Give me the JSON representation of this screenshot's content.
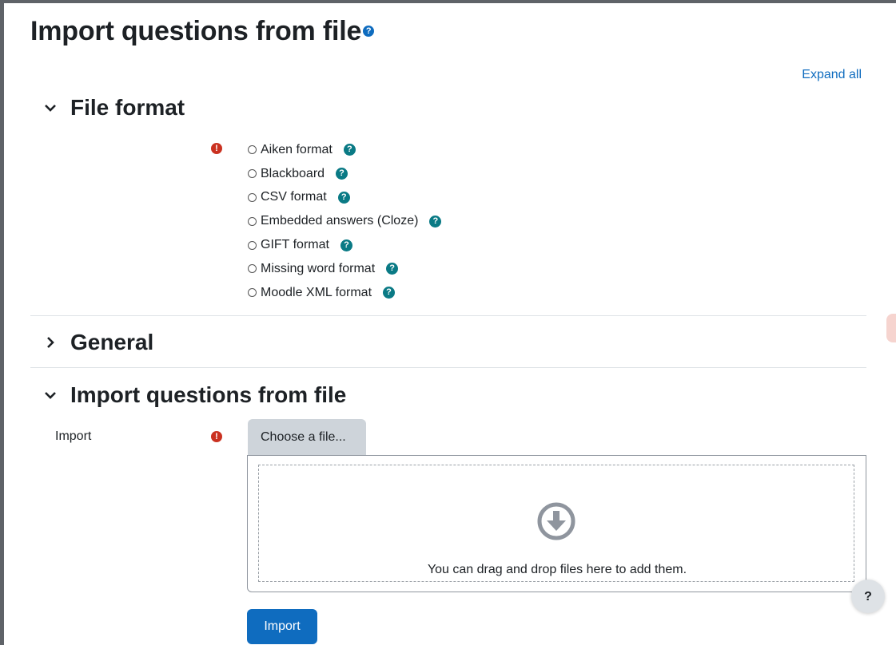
{
  "page": {
    "title": "Import questions from file",
    "title_help_icon": "question-circle-icon"
  },
  "expand_all_label": "Expand all",
  "colors": {
    "link": "#0f6cbf",
    "required": "#ca3120",
    "help": "#0a7a85",
    "primary_button": "#0f6cbf"
  },
  "sections": {
    "file_format": {
      "title": "File format",
      "expanded": true,
      "required_icon": "exclamation-circle-icon",
      "options": [
        {
          "label": "Aiken format",
          "help_icon": "question-circle-icon"
        },
        {
          "label": "Blackboard",
          "help_icon": "question-circle-icon"
        },
        {
          "label": "CSV format",
          "help_icon": "question-circle-icon"
        },
        {
          "label": "Embedded answers (Cloze)",
          "help_icon": "question-circle-icon"
        },
        {
          "label": "GIFT format",
          "help_icon": "question-circle-icon"
        },
        {
          "label": "Missing word format",
          "help_icon": "question-circle-icon"
        },
        {
          "label": "Moodle XML format",
          "help_icon": "question-circle-icon"
        }
      ]
    },
    "general": {
      "title": "General",
      "expanded": false
    },
    "import_file": {
      "title": "Import questions from file",
      "expanded": true,
      "field_label": "Import",
      "choose_button": "Choose a file...",
      "drop_text": "You can drag and drop files here to add them.",
      "drop_icon": "arrow-circle-down-icon"
    }
  },
  "import_button": "Import",
  "floating_help": "?"
}
